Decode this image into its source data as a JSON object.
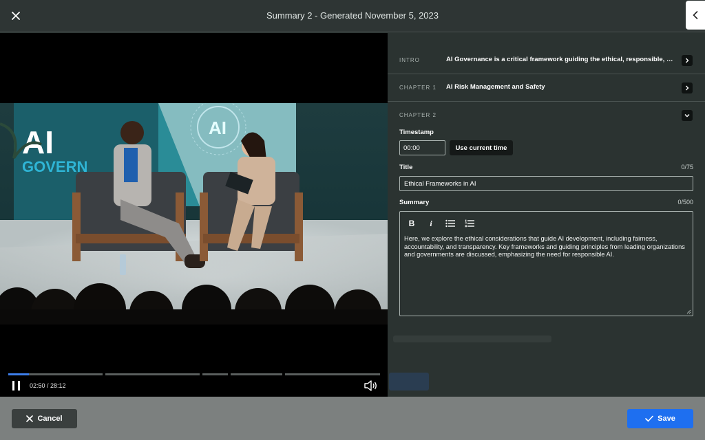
{
  "header": {
    "title": "Summary 2 - Generated November 5, 2023",
    "close_icon": "close-icon",
    "collapse_icon": "chevron-left-icon"
  },
  "video": {
    "time_readout": "02:50 / 28:12",
    "progress_fraction": 0.1,
    "stage_sign_line1": "AI",
    "stage_sign_line2": "GOVERN",
    "screen_text": "AI"
  },
  "chapters": [
    {
      "label": "INTRO",
      "text": "AI Governance is a critical framework guiding the ethical, responsible, an...",
      "icon": "chevron-right-icon"
    },
    {
      "label": "CHAPTER 1",
      "text": "AI Risk Management and Safety",
      "icon": "chevron-right-icon"
    },
    {
      "label": "CHAPTER 2",
      "text": "",
      "icon": "chevron-down-icon"
    }
  ],
  "editor": {
    "timestamp_label": "Timestamp",
    "timestamp_value": "00:00",
    "use_current_time": "Use current time",
    "title_label": "Title",
    "title_counter": "0/75",
    "title_value": "Ethical Frameworks in AI",
    "summary_label": "Summary",
    "summary_counter": "0/500",
    "toolbar": {
      "bold": "B",
      "italic": "i"
    },
    "summary_text": "Here, we explore the ethical considerations that guide AI development, including fairness, accountability, and transparency. Key frameworks and guiding principles from leading organizations and governments are discussed, emphasizing the need for responsible AI."
  },
  "footer": {
    "cancel_label": "Cancel",
    "save_label": "Save"
  },
  "colors": {
    "accent": "#1e6ff0",
    "panel": "#2b3331",
    "progress": "#3d7eea"
  }
}
